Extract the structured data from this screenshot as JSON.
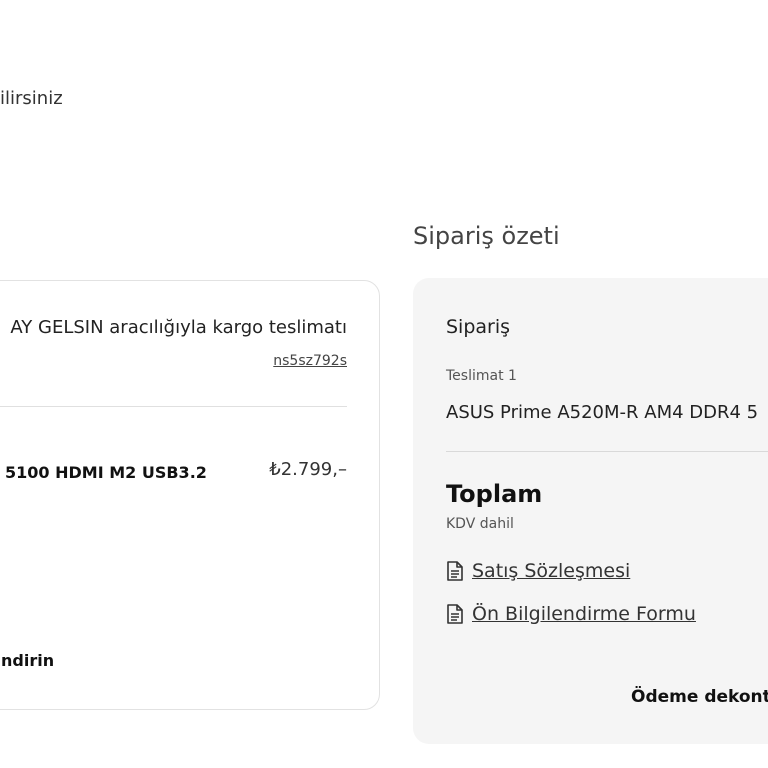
{
  "header": {
    "note": "ilirsiniz"
  },
  "delivery": {
    "title": "AY GELSIN aracılığıyla kargo teslimatı",
    "tracking_code": "ns5sz792s",
    "product_name": "5100 HDMI M2 USB3.2",
    "product_price": "₺2.799,–",
    "action_label": "ndirin"
  },
  "summary": {
    "heading": "Sipariş özeti",
    "order_title": "Sipariş",
    "shipment_label": "Teslimat 1",
    "product_name": "ASUS Prime A520M-R AM4 DDR4 5",
    "total_label": "Toplam",
    "vat_label": "KDV dahil",
    "sales_contract_label": "Satış Sözleşmesi",
    "info_form_label": "Ön Bilgilendirme Formu",
    "receipt_label": "Ödeme dekontu"
  },
  "icons": {
    "document": "document-icon"
  }
}
